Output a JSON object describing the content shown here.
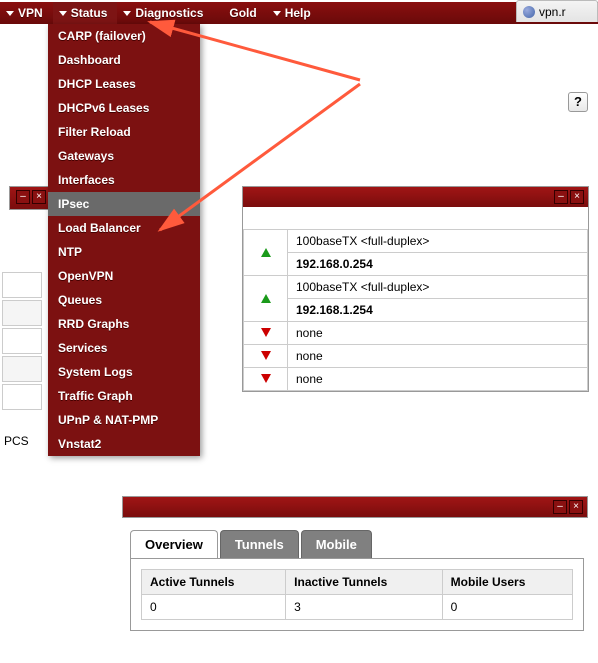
{
  "nav": {
    "items": [
      {
        "label": "VPN"
      },
      {
        "label": "Status"
      },
      {
        "label": "Diagnostics"
      },
      {
        "label": "Gold"
      },
      {
        "label": "Help"
      }
    ]
  },
  "browser_tab": {
    "label": "vpn.r"
  },
  "help_icon": "?",
  "dropdown": {
    "items": [
      "CARP (failover)",
      "Dashboard",
      "DHCP Leases",
      "DHCPv6 Leases",
      "Filter Reload",
      "Gateways",
      "Interfaces",
      "IPsec",
      "Load Balancer",
      "NTP",
      "OpenVPN",
      "Queues",
      "RRD Graphs",
      "Services",
      "System Logs",
      "Traffic Graph",
      "UPnP & NAT-PMP",
      "Vnstat2"
    ],
    "hovered_index": 7
  },
  "left_label": "PCS",
  "interfaces": [
    {
      "dir": "up",
      "line1": "100baseTX <full-duplex>",
      "line2": "192.168.0.254"
    },
    {
      "dir": "up",
      "line1": "100baseTX <full-duplex>",
      "line2": "192.168.1.254"
    },
    {
      "dir": "down",
      "line1": "none"
    },
    {
      "dir": "down",
      "line1": "none"
    },
    {
      "dir": "down",
      "line1": "none"
    }
  ],
  "tabs": {
    "items": [
      {
        "label": "Overview",
        "active": true
      },
      {
        "label": "Tunnels",
        "active": false
      },
      {
        "label": "Mobile",
        "active": false
      }
    ]
  },
  "tunnels_table": {
    "headers": [
      "Active Tunnels",
      "Inactive Tunnels",
      "Mobile Users"
    ],
    "row": [
      "0",
      "3",
      "0"
    ]
  },
  "winbtn": {
    "min": "–",
    "close": "×"
  }
}
